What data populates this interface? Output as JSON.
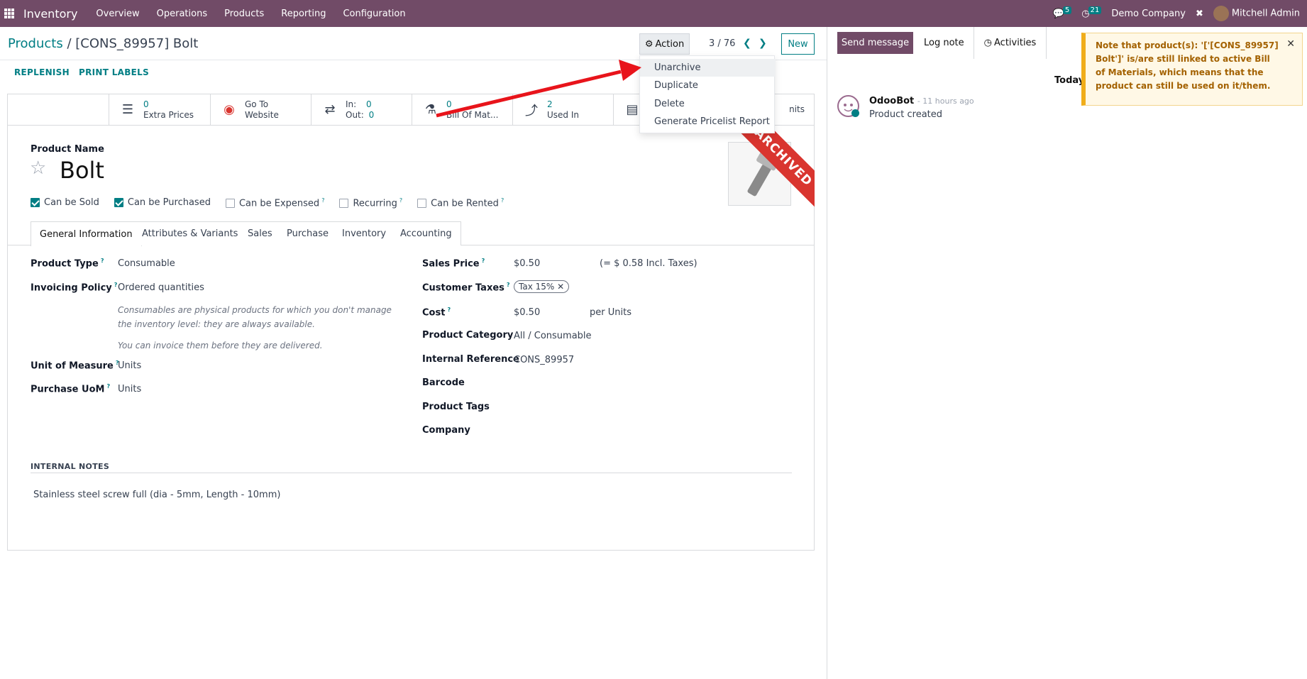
{
  "topbar": {
    "app": "Inventory",
    "menus": [
      "Overview",
      "Operations",
      "Products",
      "Reporting",
      "Configuration"
    ],
    "messages_count": "5",
    "activities_count": "21",
    "company": "Demo Company",
    "user": "Mitchell Admin"
  },
  "breadcrumb": {
    "parent": "Products",
    "sep": "/",
    "current": "[CONS_89957] Bolt"
  },
  "control": {
    "action": "Action",
    "pager": "3 / 76",
    "new": "New",
    "replenish": "REPLENISH",
    "print_labels": "PRINT LABELS"
  },
  "action_menu": [
    "Unarchive",
    "Duplicate",
    "Delete",
    "Generate Pricelist Report"
  ],
  "smart": {
    "extra_prices_num": "0",
    "extra_prices": "Extra Prices",
    "goto_1": "Go To",
    "goto_2": "Website",
    "in_label": "In:",
    "in_val": "0",
    "out_label": "Out:",
    "out_val": "0",
    "bom_num": "0",
    "bom": "Bill Of Mat...",
    "used_num": "2",
    "used": "Used In",
    "units": "nits"
  },
  "ribbon": "ARCHIVED",
  "product": {
    "name_label": "Product Name",
    "name": "Bolt"
  },
  "checks": [
    {
      "label": "Can be Sold",
      "on": true
    },
    {
      "label": "Can be Purchased",
      "on": true
    },
    {
      "label": "Can be Expensed",
      "on": false
    },
    {
      "label": "Recurring",
      "on": false
    },
    {
      "label": "Can be Rented",
      "on": false
    }
  ],
  "tabs": [
    "General Information",
    "Attributes & Variants",
    "Sales",
    "Purchase",
    "Inventory",
    "Accounting"
  ],
  "left": {
    "product_type_l": "Product Type",
    "product_type": "Consumable",
    "invoicing_l": "Invoicing Policy",
    "invoicing": "Ordered quantities",
    "hint1": "Consumables are physical products for which you don't manage the inventory level: they are always available.",
    "hint2": "You can invoice them before they are delivered.",
    "uom_l": "Unit of Measure",
    "uom": "Units",
    "puom_l": "Purchase UoM",
    "puom": "Units"
  },
  "right": {
    "sales_price_l": "Sales Price",
    "sales_price": "$0.50",
    "incl": "(= $ 0.58 Incl. Taxes)",
    "taxes_l": "Customer Taxes",
    "tax": "Tax 15%",
    "cost_l": "Cost",
    "cost": "$0.50",
    "per": "per Units",
    "category_l": "Product Category",
    "category": "All / Consumable",
    "ref_l": "Internal Reference",
    "ref": "CONS_89957",
    "barcode_l": "Barcode",
    "tags_l": "Product Tags",
    "company_l": "Company"
  },
  "notes": {
    "heading": "INTERNAL NOTES",
    "text": "Stainless steel screw full (dia - 5mm, Length - 10mm)"
  },
  "chatter": {
    "send": "Send message",
    "log": "Log note",
    "activities": "Activities",
    "today": "Today",
    "author": "OdooBot",
    "time": "- 11 hours ago",
    "message": "Product created"
  },
  "notification": "Note that product(s): '['[CONS_89957] Bolt']' is/are still linked to active Bill of Materials, which means that the product can still be used on it/them.",
  "colors": {
    "brand": "#714b67",
    "accent": "#017e84",
    "ribbon": "#d9352f",
    "arrow": "#e8141b"
  }
}
